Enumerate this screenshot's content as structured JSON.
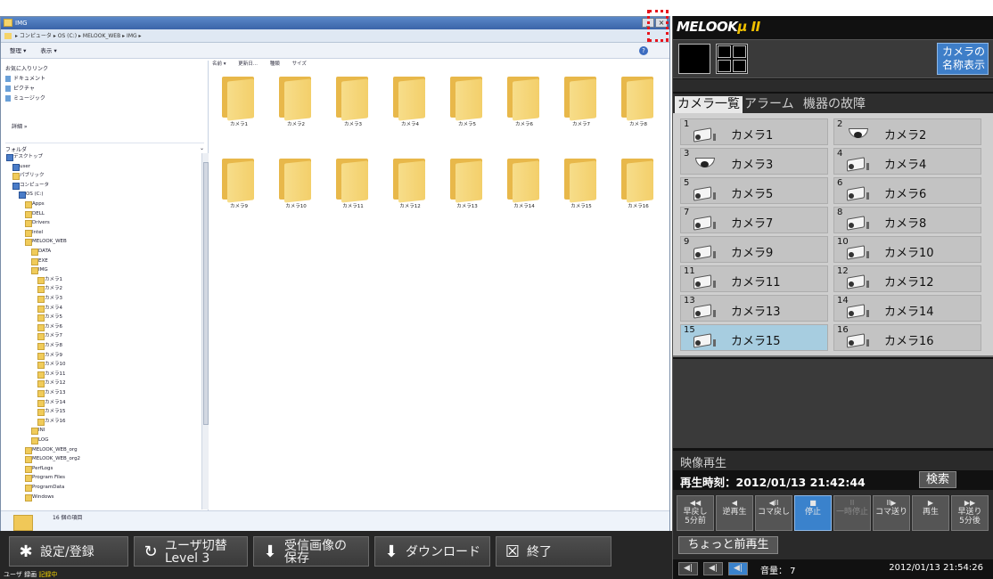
{
  "explorer": {
    "title": "IMG",
    "breadcrumb": "▸ コンピュータ ▸ OS (C:) ▸ MELOOK_WEB ▸ IMG ▸",
    "toolbar": {
      "organize": "整理 ▾",
      "view": "表示 ▾"
    },
    "favorites_head": "お気に入りリンク",
    "favorites": [
      "ドキュメント",
      "ピクチャ",
      "ミュージック"
    ],
    "details_label": "詳細 »",
    "folders_label": "フォルダ",
    "columns": [
      "名前 ▾",
      "更新日...",
      "種類",
      "サイズ"
    ],
    "tree": [
      {
        "label": "デスクトップ",
        "indent": 0,
        "blue": true
      },
      {
        "label": "user",
        "indent": 1,
        "blue": true
      },
      {
        "label": "パブリック",
        "indent": 1,
        "blue": false
      },
      {
        "label": "コンピュータ",
        "indent": 1,
        "blue": true
      },
      {
        "label": "OS (C:)",
        "indent": 2,
        "blue": true
      },
      {
        "label": "Apps",
        "indent": 3,
        "blue": false
      },
      {
        "label": "DELL",
        "indent": 3,
        "blue": false
      },
      {
        "label": "Drivers",
        "indent": 3,
        "blue": false
      },
      {
        "label": "Intel",
        "indent": 3,
        "blue": false
      },
      {
        "label": "MELOOK_WEB",
        "indent": 3,
        "blue": false
      },
      {
        "label": "DATA",
        "indent": 4,
        "blue": false
      },
      {
        "label": "EXE",
        "indent": 4,
        "blue": false
      },
      {
        "label": "IMG",
        "indent": 4,
        "blue": false
      },
      {
        "label": "カメラ1",
        "indent": 5,
        "blue": false
      },
      {
        "label": "カメラ2",
        "indent": 5,
        "blue": false
      },
      {
        "label": "カメラ3",
        "indent": 5,
        "blue": false
      },
      {
        "label": "カメラ4",
        "indent": 5,
        "blue": false
      },
      {
        "label": "カメラ5",
        "indent": 5,
        "blue": false
      },
      {
        "label": "カメラ6",
        "indent": 5,
        "blue": false
      },
      {
        "label": "カメラ7",
        "indent": 5,
        "blue": false
      },
      {
        "label": "カメラ8",
        "indent": 5,
        "blue": false
      },
      {
        "label": "カメラ9",
        "indent": 5,
        "blue": false
      },
      {
        "label": "カメラ10",
        "indent": 5,
        "blue": false
      },
      {
        "label": "カメラ11",
        "indent": 5,
        "blue": false
      },
      {
        "label": "カメラ12",
        "indent": 5,
        "blue": false
      },
      {
        "label": "カメラ13",
        "indent": 5,
        "blue": false
      },
      {
        "label": "カメラ14",
        "indent": 5,
        "blue": false
      },
      {
        "label": "カメラ15",
        "indent": 5,
        "blue": false
      },
      {
        "label": "カメラ16",
        "indent": 5,
        "blue": false
      },
      {
        "label": "INI",
        "indent": 4,
        "blue": false
      },
      {
        "label": "LOG",
        "indent": 4,
        "blue": false
      },
      {
        "label": "MELOOK_WEB_org",
        "indent": 3,
        "blue": false
      },
      {
        "label": "MELOOK_WEB_org2",
        "indent": 3,
        "blue": false
      },
      {
        "label": "PerfLogs",
        "indent": 3,
        "blue": false
      },
      {
        "label": "Program Files",
        "indent": 3,
        "blue": false
      },
      {
        "label": "ProgramData",
        "indent": 3,
        "blue": false
      },
      {
        "label": "Windows",
        "indent": 3,
        "blue": false
      }
    ],
    "folders": [
      "カメラ1",
      "カメラ2",
      "カメラ3",
      "カメラ4",
      "カメラ5",
      "カメラ6",
      "カメラ7",
      "カメラ8",
      "カメラ9",
      "カメラ10",
      "カメラ11",
      "カメラ12",
      "カメラ13",
      "カメラ14",
      "カメラ15",
      "カメラ16"
    ],
    "status_count": "16 個の項目"
  },
  "bottombar": {
    "settings": "設定/登録",
    "user_switch_1": "ユーザ切替",
    "user_switch_2": "Level 3",
    "save_1": "受信画像の",
    "save_2": "保存",
    "download": "ダウンロード",
    "exit": "終了",
    "status_prefix": "ユーザ 録画",
    "status_rec": "記録中"
  },
  "panel": {
    "brand": "MELOOK",
    "brand_mu": "μ II",
    "camera_name_btn_1": "カメラの",
    "camera_name_btn_2": "名称表示",
    "tabs": [
      "カメラ一覧",
      "アラーム",
      "機器の故障"
    ],
    "cameras": [
      {
        "num": "1",
        "name": "カメラ1",
        "type": "box"
      },
      {
        "num": "2",
        "name": "カメラ2",
        "type": "dome"
      },
      {
        "num": "3",
        "name": "カメラ3",
        "type": "dome"
      },
      {
        "num": "4",
        "name": "カメラ4",
        "type": "box"
      },
      {
        "num": "5",
        "name": "カメラ5",
        "type": "box"
      },
      {
        "num": "6",
        "name": "カメラ6",
        "type": "box"
      },
      {
        "num": "7",
        "name": "カメラ7",
        "type": "box"
      },
      {
        "num": "8",
        "name": "カメラ8",
        "type": "box"
      },
      {
        "num": "9",
        "name": "カメラ9",
        "type": "box"
      },
      {
        "num": "10",
        "name": "カメラ10",
        "type": "box"
      },
      {
        "num": "11",
        "name": "カメラ11",
        "type": "box"
      },
      {
        "num": "12",
        "name": "カメラ12",
        "type": "box"
      },
      {
        "num": "13",
        "name": "カメラ13",
        "type": "box"
      },
      {
        "num": "14",
        "name": "カメラ14",
        "type": "box"
      },
      {
        "num": "15",
        "name": "カメラ15",
        "type": "box",
        "selected": true
      },
      {
        "num": "16",
        "name": "カメラ16",
        "type": "box"
      }
    ],
    "playback_title": "映像再生",
    "playback_time": "再生時刻：2012/01/13 21:42:44",
    "search": "検索",
    "controls": [
      {
        "sym": "◀◀",
        "l1": "早戻し",
        "l2": "5分前",
        "state": "normal"
      },
      {
        "sym": "◀",
        "l1": "",
        "l2": "逆再生",
        "state": "normal"
      },
      {
        "sym": "◀II",
        "l1": "",
        "l2": "コマ戻し",
        "state": "normal"
      },
      {
        "sym": "■",
        "l1": "",
        "l2": "停止",
        "state": "active"
      },
      {
        "sym": "II",
        "l1": "",
        "l2": "一時停止",
        "state": "disabled"
      },
      {
        "sym": "II▶",
        "l1": "",
        "l2": "コマ送り",
        "state": "normal"
      },
      {
        "sym": "▶",
        "l1": "",
        "l2": "再生",
        "state": "normal"
      },
      {
        "sym": "▶▶",
        "l1": "早送り",
        "l2": "5分後",
        "state": "normal"
      }
    ],
    "short_replay": "ちょっと前再生",
    "volume": "音量： 7",
    "clock": "2012/01/13 21:54:26"
  }
}
